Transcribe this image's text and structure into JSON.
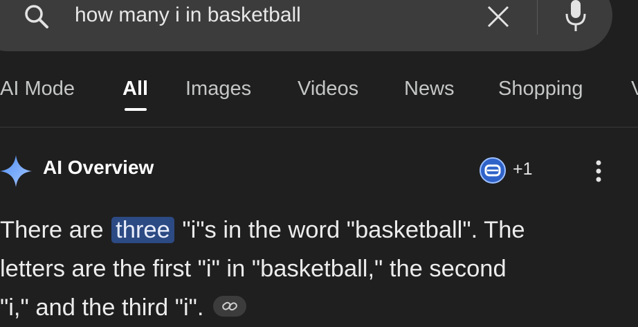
{
  "search": {
    "query": "how many i in basketball",
    "icons": [
      "search-icon",
      "close-icon",
      "mic-icon"
    ]
  },
  "tabs": [
    {
      "label": "AI Mode",
      "active": false
    },
    {
      "label": "All",
      "active": true
    },
    {
      "label": "Images",
      "active": false
    },
    {
      "label": "Videos",
      "active": false
    },
    {
      "label": "News",
      "active": false
    },
    {
      "label": "Shopping",
      "active": false
    }
  ],
  "ai_overview": {
    "title": "AI Overview",
    "source_count": "+1",
    "answer": {
      "line1_before": "There are ",
      "highlight": "three",
      "line1_after": " \"i\"s in the word \"basketball\". The",
      "line2": "letters are the first \"i\" in \"basketball,\" the second",
      "line3": "\"i,\" and the third \"i\"."
    }
  },
  "colors": {
    "background": "#1f1f1f",
    "search_bar": "#3c3c3c",
    "highlight": "#2c4a83",
    "sparkle": "#8ab4f8"
  }
}
